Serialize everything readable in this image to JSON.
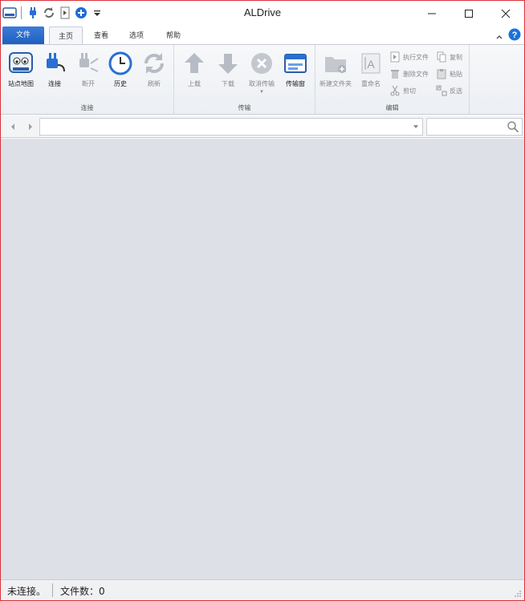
{
  "window": {
    "title": "ALDrive",
    "border_color": "#d7323a"
  },
  "tabs": {
    "file": "文件",
    "items": [
      "主页",
      "查看",
      "选项",
      "帮助"
    ],
    "active": "主页"
  },
  "ribbon": {
    "groups": {
      "connect": {
        "label": "连接",
        "buttons": [
          "站点地图",
          "连接",
          "断开",
          "历史",
          "刷新"
        ]
      },
      "transfer": {
        "label": "传输",
        "buttons": [
          "上载",
          "下载",
          "取消传输",
          "传输窗"
        ]
      },
      "edit": {
        "label": "编辑",
        "big_buttons": [
          "新建文件夹",
          "重命名"
        ],
        "small_buttons": [
          "执行文件",
          "删除文件",
          "剪切",
          "复制",
          "粘贴",
          "反选"
        ]
      }
    }
  },
  "address": {
    "value": ""
  },
  "search": {
    "value": ""
  },
  "status": {
    "connection": "未连接。",
    "file_count": "文件数：0"
  },
  "colors": {
    "accent": "#1f5fbf",
    "main_bg": "#dde1e7",
    "help_blue": "#1a73d9"
  }
}
